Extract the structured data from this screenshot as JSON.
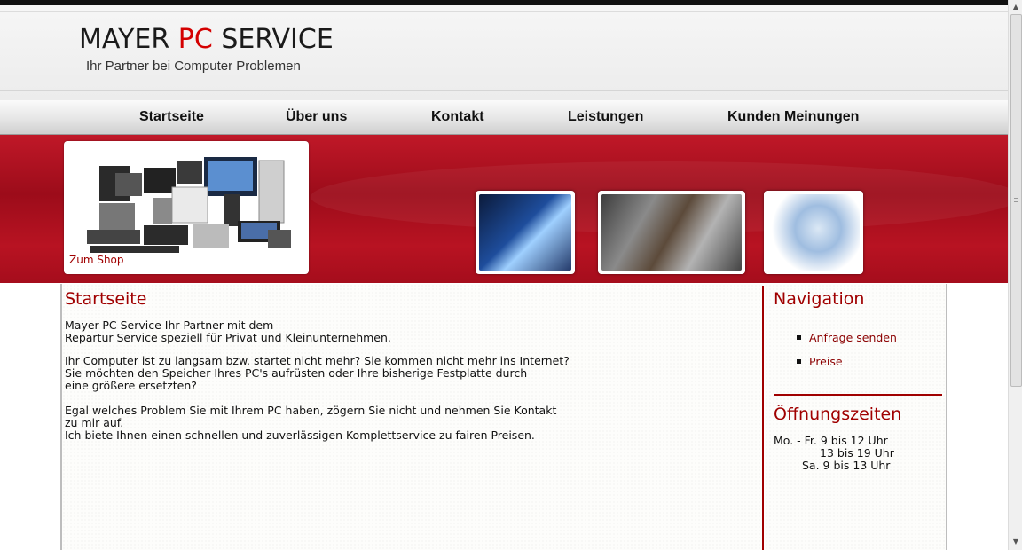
{
  "header": {
    "logo_part1": "MAYER ",
    "logo_part2": "PC",
    "logo_part3": " SERVICE",
    "tagline": "Ihr Partner bei Computer Problemen"
  },
  "nav": {
    "items": [
      "Startseite",
      "Über uns",
      "Kontakt",
      "Leistungen",
      "Kunden Meinungen"
    ]
  },
  "banner": {
    "shop_link": "Zum Shop"
  },
  "main": {
    "title": "Startseite",
    "p1_line1": "Mayer-PC Service Ihr Partner mit dem",
    "p1_line2": "Repartur Service speziell für Privat und Kleinunternehmen.",
    "p2_line1": "Ihr Computer ist zu langsam bzw. startet nicht mehr? Sie kommen nicht mehr ins Internet?",
    "p2_line2": "Sie möchten den Speicher Ihres PC's aufrüsten oder Ihre bisherige Festplatte durch",
    "p2_line3": "eine größere ersetzten?",
    "p3_line1": "Egal welches Problem Sie mit Ihrem PC haben, zögern Sie nicht und nehmen Sie Kontakt",
    "p3_line2": "zu mir auf.",
    "p3_line3": "Ich biete Ihnen einen schnellen und zuverlässigen Komplettservice zu fairen Preisen."
  },
  "sidebar": {
    "nav_title": "Navigation",
    "nav_items": [
      "Anfrage senden",
      "Preise"
    ],
    "hours_title": "Öffnungszeiten",
    "hours_line1": "Mo. - Fr. 9 bis 12 Uhr",
    "hours_line2": "13 bis 19 Uhr",
    "hours_line3": "Sa. 9 bis 13 Uhr"
  },
  "colors": {
    "brand_red": "#a00000",
    "banner_red": "#b01322"
  }
}
